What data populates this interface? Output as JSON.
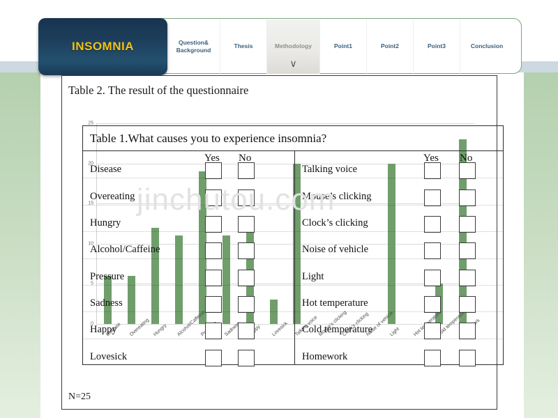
{
  "nav": {
    "logo": "INSOMNIA",
    "tabs": [
      {
        "label": "Question&\nBackground",
        "active": false
      },
      {
        "label": "Thesis",
        "active": false
      },
      {
        "label": "Methodology",
        "active": true
      },
      {
        "label": "Point1",
        "active": false
      },
      {
        "label": "Point2",
        "active": false
      },
      {
        "label": "Point3",
        "active": false
      },
      {
        "label": "Conclusion",
        "active": false
      }
    ],
    "chevron": "∨"
  },
  "slide": {
    "title": "Table 2. The result of the questionnaire",
    "footnote": "N=25"
  },
  "watermark": "jinchutou.com",
  "overlay_table": {
    "title": "Table 1.What causes you to experience insomnia?",
    "yes_header": "Yes",
    "no_header": "No",
    "left_rows": [
      "Disease",
      "Overeating",
      "Hungry",
      "Alcohol/Caffeine",
      "Pressure",
      "Sadness",
      "Happy",
      "Lovesick"
    ],
    "right_rows": [
      "Talking voice",
      "Mouse’s clicking",
      "Clock’s clicking",
      "Noise of vehicle",
      "Light",
      "Hot temperature",
      "Cold temperature",
      "Homework"
    ]
  },
  "chart_data": {
    "type": "bar",
    "title": "",
    "xlabel": "",
    "ylabel": "",
    "ylim": [
      0,
      25
    ],
    "yticks": [
      0,
      5,
      10,
      15,
      20,
      25
    ],
    "grid": true,
    "legend": "none",
    "bar_color": "#6f9e6b",
    "categories": [
      "Disease",
      "Overeating",
      "Hungry",
      "Alcohol/Caffeine",
      "Pressure",
      "Sadness",
      "Happy",
      "Lovesick",
      "Talking voice",
      "Mouse’s clicking",
      "Clock’s clicking",
      "Noise of vehicle",
      "Light",
      "Hot temperature",
      "Cold temperature",
      "Homework"
    ],
    "values": [
      6,
      6,
      12,
      11,
      19,
      11,
      12,
      3,
      20,
      0,
      0,
      0,
      20,
      0,
      5,
      23
    ]
  }
}
